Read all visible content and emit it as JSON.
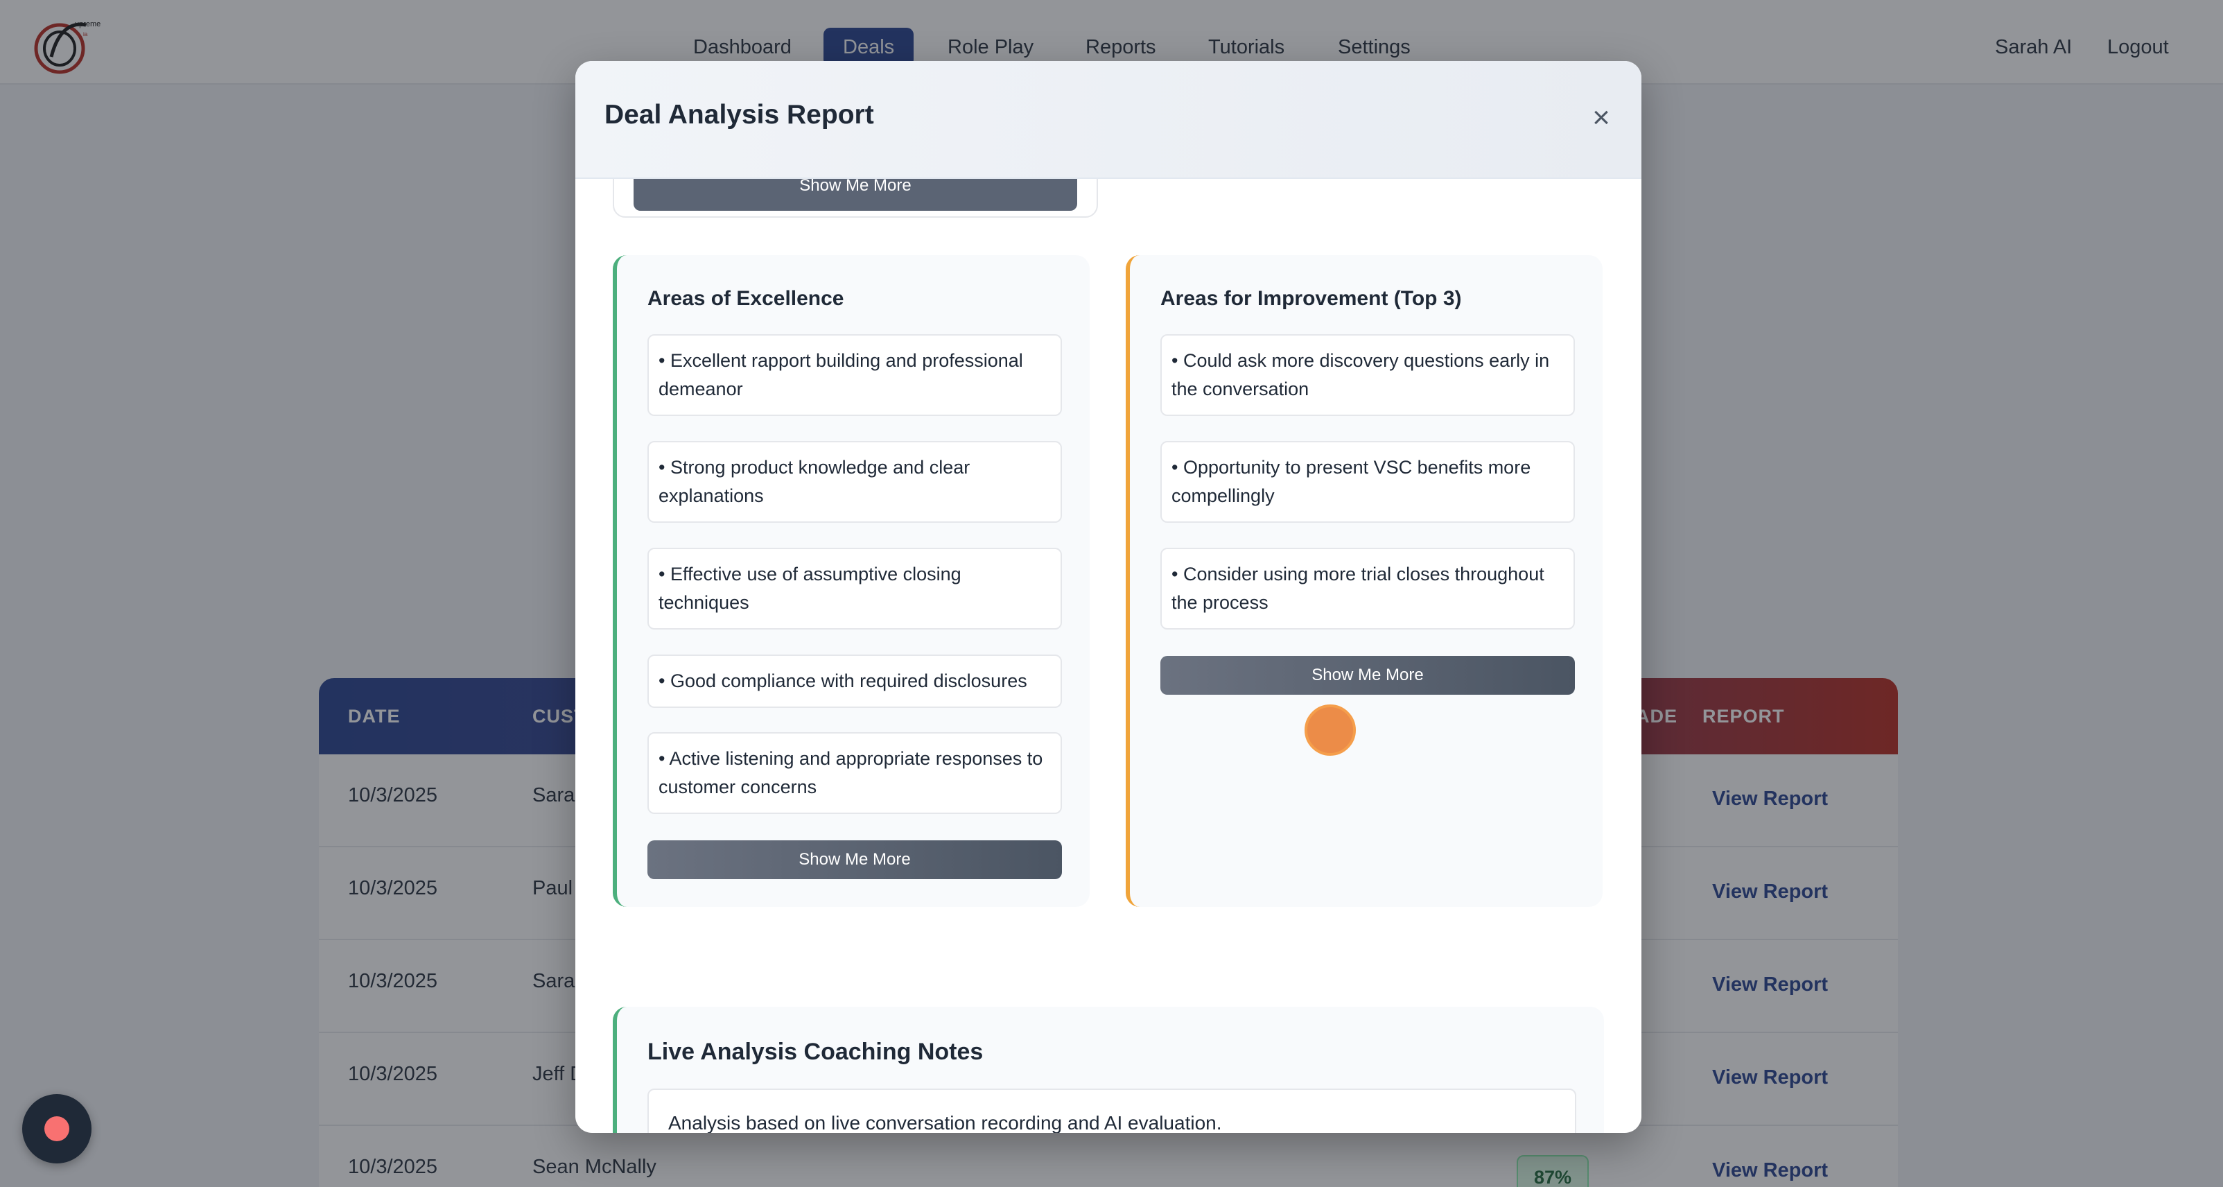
{
  "nav": {
    "items": [
      {
        "label": "Dashboard",
        "active": false
      },
      {
        "label": "Deals",
        "active": true
      },
      {
        "label": "Role Play",
        "active": false
      },
      {
        "label": "Reports",
        "active": false
      },
      {
        "label": "Tutorials",
        "active": false
      },
      {
        "label": "Settings",
        "active": false
      }
    ],
    "user_name": "Sarah AI",
    "logout": "Logout"
  },
  "table": {
    "headers": {
      "date": "DATE",
      "customer": "CUST",
      "grade": "ADE",
      "report": "REPORT"
    },
    "rows": [
      {
        "date": "10/3/2025",
        "customer": "Sarah",
        "grade": "",
        "report": "View Report"
      },
      {
        "date": "10/3/2025",
        "customer": "Paul S",
        "grade": "",
        "report": "View Report"
      },
      {
        "date": "10/3/2025",
        "customer": "Sarah",
        "grade": "",
        "report": "View Report"
      },
      {
        "date": "10/3/2025",
        "customer": "Jeff D",
        "grade": "",
        "report": "View Report"
      },
      {
        "date": "10/3/2025",
        "customer": "Sean McNally",
        "grade": "87%",
        "report": "View Report"
      }
    ]
  },
  "modal": {
    "title": "Deal Analysis Report",
    "close": "×",
    "prev_show_more": "Show Me More",
    "excellence": {
      "title": "Areas of Excellence",
      "items": [
        "• Excellent rapport building and professional demeanor",
        "• Strong product knowledge and clear explanations",
        "• Effective use of assumptive closing techniques",
        "• Good compliance with required disclosures",
        "• Active listening and appropriate responses to customer concerns"
      ],
      "show_more": "Show Me More"
    },
    "improvement": {
      "title": "Areas for Improvement (Top 3)",
      "items": [
        "• Could ask more discovery questions early in the conversation",
        "• Opportunity to present VSC benefits more compellingly",
        "• Consider using more trial closes throughout the process"
      ],
      "show_more": "Show Me More"
    },
    "notes": {
      "title": "Live Analysis Coaching Notes",
      "text": "Analysis based on live conversation recording and AI evaluation."
    }
  },
  "colors": {
    "brand_navy": "#1e3a8a",
    "brand_red": "#b42318",
    "excellence_accent": "#4caf7d",
    "improvement_accent": "#f0a43a"
  }
}
